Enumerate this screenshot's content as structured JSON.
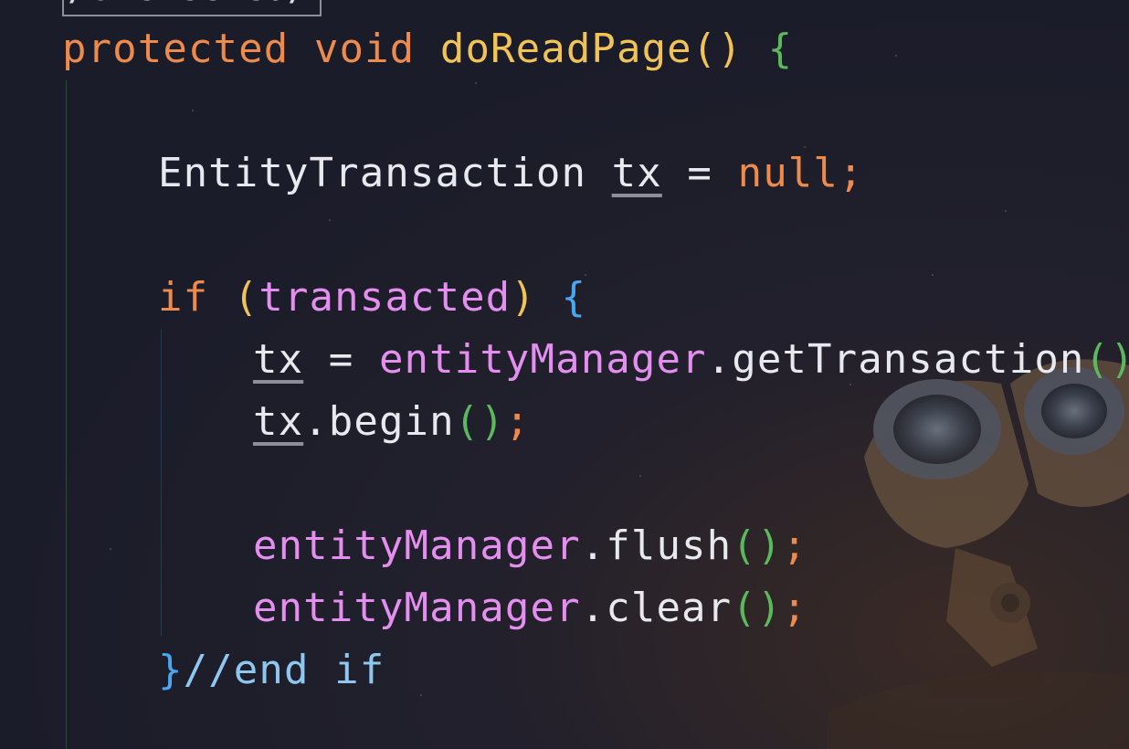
{
  "annotation_fragment": "/Unchecked/",
  "code": {
    "l1": {
      "kw1": "protected",
      "kw2": "void",
      "fn": "doReadPage",
      "paren": "()",
      "brace": "{"
    },
    "l2": {
      "type": "EntityTransaction",
      "var": "tx",
      "eq": "=",
      "null": "null",
      "semi": ";"
    },
    "l3": {
      "kw": "if",
      "po": "(",
      "cond": "transacted",
      "pc": ")",
      "brace": "{"
    },
    "l4": {
      "var": "tx",
      "eq": "=",
      "obj": "entityManager",
      "method": ".getTransaction",
      "paren": "()",
      "semi": ";"
    },
    "l5": {
      "var": "tx",
      "method": ".begin",
      "paren": "()",
      "semi": ";"
    },
    "l6": {
      "obj": "entityManager",
      "method": ".flush",
      "paren": "()",
      "semi": ";"
    },
    "l7": {
      "obj": "entityManager",
      "method": ".clear",
      "paren": "()",
      "semi": ";"
    },
    "l8": {
      "brace": "}",
      "comment": "//end if"
    }
  },
  "colors": {
    "keyword": "#ee8a4c",
    "function": "#f1c356",
    "paren": "#5cb85c",
    "brace": "#4aa7ef",
    "field": "#e48ff0",
    "comment": "#8ec8f0",
    "text": "#e7e9ee"
  },
  "background_image": "robot-binocular-eyes"
}
